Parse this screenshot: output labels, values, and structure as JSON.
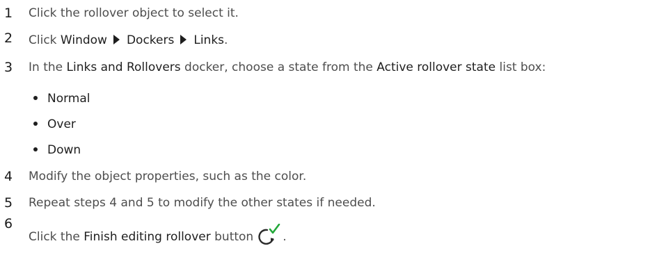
{
  "steps": [
    {
      "num": "1",
      "text": "Click the rollover object to select it."
    },
    {
      "num": "2",
      "parts": [
        "Click ",
        "Window",
        "Dockers",
        "Links",
        "."
      ]
    },
    {
      "num": "3",
      "parts": [
        "In the ",
        "Links and Rollovers",
        " docker, choose a state from the ",
        "Active rollover state",
        " list box:"
      ],
      "bullets": [
        "Normal",
        "Over",
        "Down"
      ]
    },
    {
      "num": "4",
      "text": "Modify the object properties, such as the color."
    },
    {
      "num": "5",
      "text": "Repeat steps 4 and 5 to modify the other states if needed."
    },
    {
      "num": "6",
      "parts": [
        "Click the ",
        "Finish editing rollover",
        " button",
        "."
      ]
    }
  ],
  "icons": {
    "menu_separator": "right-triangle-arrow-icon",
    "finish_editing_rollover": "finish-editing-rollover-icon"
  },
  "colors": {
    "checkmark": "#22a83a",
    "text": "#4d4d4d",
    "ui_term": "#1e1e1e"
  }
}
